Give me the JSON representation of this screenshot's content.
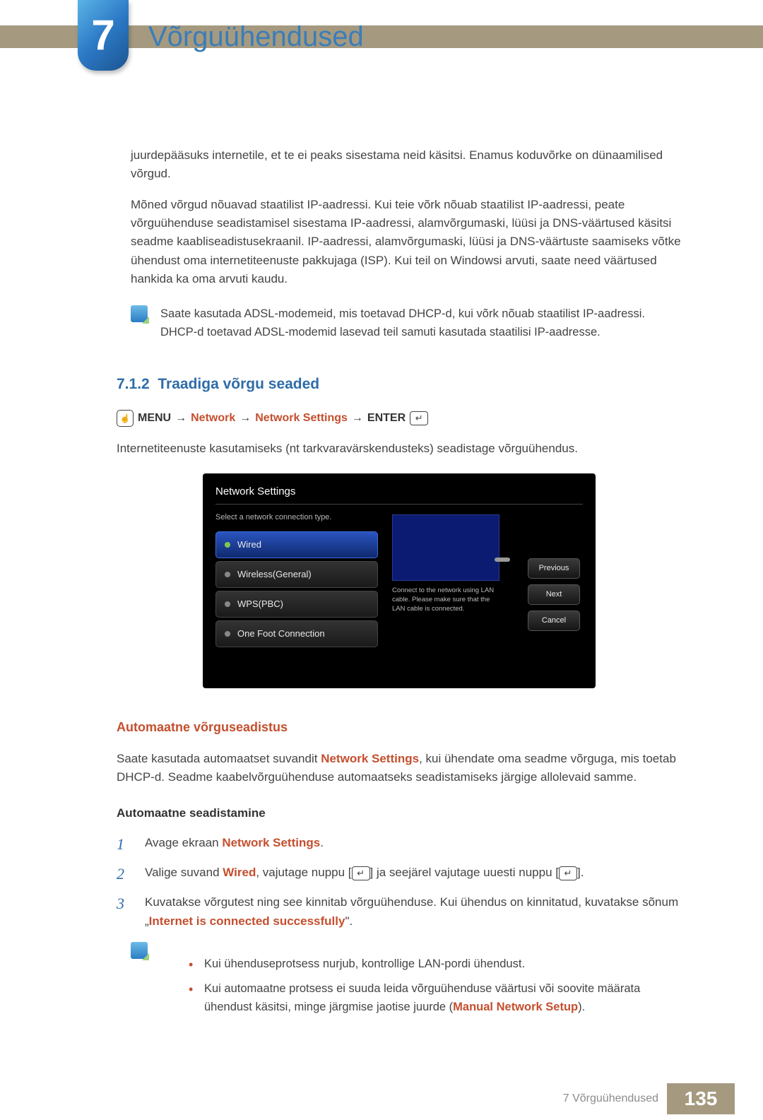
{
  "chapter": {
    "number": "7",
    "title": "Võrguühendused"
  },
  "intro": {
    "p1": "juurdepääsuks internetile, et te ei peaks sisestama neid käsitsi. Enamus koduvõrke on dünaamilised võrgud.",
    "p2": "Mõned võrgud nõuavad staatilist IP-aadressi. Kui teie võrk nõuab staatilist IP-aadressi, peate võrguühenduse seadistamisel sisestama IP-aadressi, alamvõrgumaski, lüüsi ja DNS-väärtused käsitsi seadme kaabliseadistusekraanil. IP-aadressi, alamvõrgumaski, lüüsi ja DNS-väärtuste saamiseks võtke ühendust oma internetiteenuste pakkujaga (ISP). Kui teil on Windowsi arvuti, saate need väärtused hankida ka oma arvuti kaudu."
  },
  "note1": "Saate kasutada ADSL-modemeid, mis toetavad DHCP-d, kui võrk nõuab staatilist IP-aadressi. DHCP-d toetavad ADSL-modemid lasevad teil samuti kasutada staatilisi IP-aadresse.",
  "section712": {
    "heading_num": "7.1.2",
    "heading_txt": "Traadiga võrgu seaded",
    "path": {
      "menu": "MENU",
      "network": "Network",
      "network_settings": "Network Settings",
      "enter": "ENTER"
    },
    "intro": "Internetiteenuste kasutamiseks (nt tarkvaravärskendusteks) seadistage võrguühendus."
  },
  "osd": {
    "title": "Network Settings",
    "subtitle": "Select a network connection type.",
    "options": [
      "Wired",
      "Wireless(General)",
      "WPS(PBC)",
      "One Foot Connection"
    ],
    "help": "Connect to the network using LAN cable. Please make sure that the LAN cable is connected.",
    "buttons": {
      "prev": "Previous",
      "next": "Next",
      "cancel": "Cancel"
    }
  },
  "auto": {
    "heading": "Automaatne võrguseadistus",
    "p_before": "Saate kasutada automaatset suvandit ",
    "p_link": "Network Settings",
    "p_after": ", kui ühendate oma seadme võrguga, mis toetab DHCP-d. Seadme kaabelvõrguühenduse automaatseks seadistamiseks järgige allolevaid samme.",
    "sub": "Automaatne seadistamine",
    "steps": {
      "s1_a": "Avage ekraan ",
      "s1_link": "Network Settings",
      "s1_b": ".",
      "s2_a": "Valige suvand ",
      "s2_wired": "Wired",
      "s2_b": ", vajutage nuppu [",
      "s2_c": "] ja seejärel vajutage uuesti nuppu [",
      "s2_d": "].",
      "s3_a": "Kuvatakse võrgutest ning see kinnitab võrguühenduse. Kui ühendus on kinnitatud, kuvatakse sõnum „",
      "s3_msg": "Internet is connected successfully",
      "s3_b": "\"."
    },
    "bullets": {
      "b1": "Kui ühenduseprotsess nurjub, kontrollige LAN-pordi ühendust.",
      "b2_a": "Kui automaatne protsess ei suuda leida võrguühenduse väärtusi või soovite määrata ühendust käsitsi, minge järgmise jaotise juurde (",
      "b2_link": "Manual Network Setup",
      "b2_b": ")."
    }
  },
  "footer": {
    "text": "7 Võrguühendused",
    "page": "135"
  }
}
